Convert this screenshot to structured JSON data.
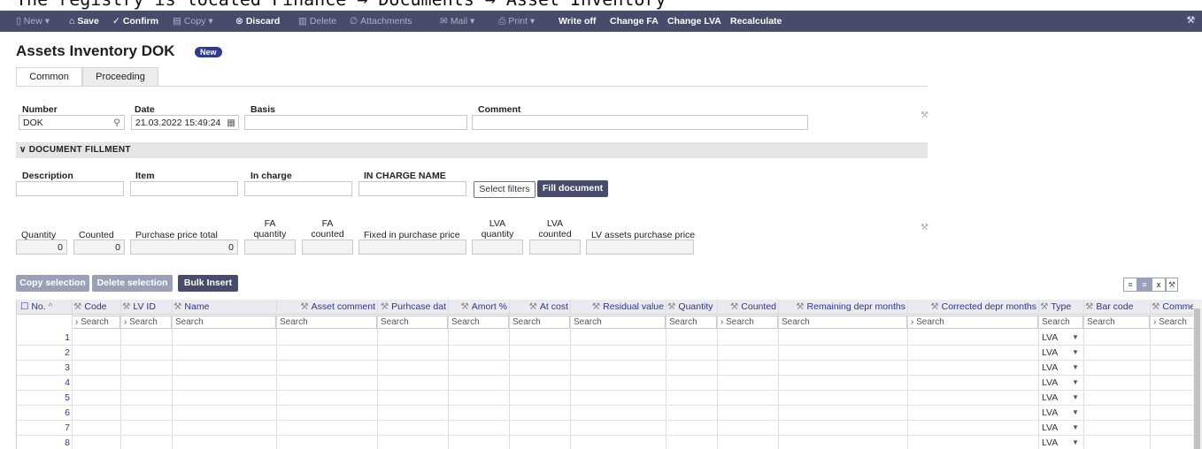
{
  "header_caption": "The registry is located Finance → Documents → Asset Inventory",
  "toolbar": {
    "new": "New",
    "save": "Save",
    "confirm": "Confirm",
    "copy": "Copy",
    "discard": "Discard",
    "delete": "Delete",
    "attachments": "Attachments",
    "mail": "Mail",
    "print": "Print",
    "write_off": "Write off",
    "change_fa": "Change FA",
    "change_lva": "Change LVA",
    "recalculate": "Recalculate"
  },
  "page": {
    "title": "Assets Inventory DOK",
    "badge": "New"
  },
  "tabs": [
    "Common",
    "Proceeding"
  ],
  "form": {
    "number_label": "Number",
    "number_value": "DOK",
    "date_label": "Date",
    "date_value": "21.03.2022 15:49:24",
    "basis_label": "Basis",
    "comment_label": "Comment"
  },
  "fillment": {
    "section_title": "DOCUMENT FILLMENT",
    "description": "Description",
    "item": "Item",
    "in_charge": "In charge",
    "in_charge_name": "IN CHARGE NAME",
    "select_filters": "Select filters",
    "fill_document": "Fill document"
  },
  "totals": {
    "quantity_label": "Quantity",
    "quantity_value": "0",
    "counted_label": "Counted",
    "counted_value": "0",
    "purchase_total_label": "Purchase price total",
    "purchase_total_value": "0",
    "fa_quantity_1": "FA",
    "fa_quantity_2": "quantity",
    "fa_counted_1": "FA",
    "fa_counted_2": "counted",
    "fixed_purchase": "Fixed in purchase price",
    "lva_quantity_1": "LVA",
    "lva_quantity_2": "quantity",
    "lva_counted_1": "LVA",
    "lva_counted_2": "counted",
    "lv_purchase": "LV assets purchase price"
  },
  "grid_buttons": {
    "copy_selection": "Copy selection",
    "delete_selection": "Delete selection",
    "bulk_insert": "Bulk Insert"
  },
  "grid": {
    "columns": [
      "No.",
      "Code",
      "LV ID",
      "Name",
      "Asset comment",
      "Purhcase dat",
      "Amort %",
      "At cost",
      "Residual value",
      "Quantity",
      "Counted",
      "Remaining depr months",
      "Corrected depr months",
      "Type",
      "Bar code",
      "Comme"
    ],
    "search_placeholder": "Search",
    "rows": [
      {
        "no": "1",
        "type": "LVA"
      },
      {
        "no": "2",
        "type": "LVA"
      },
      {
        "no": "3",
        "type": "LVA"
      },
      {
        "no": "4",
        "type": "LVA"
      },
      {
        "no": "5",
        "type": "LVA"
      },
      {
        "no": "6",
        "type": "LVA"
      },
      {
        "no": "7",
        "type": "LVA"
      },
      {
        "no": "8",
        "type": "LVA"
      }
    ]
  },
  "colors": {
    "toolbar": "#484b6b",
    "accent": "#2c3590",
    "badge": "#2f3a8c"
  }
}
